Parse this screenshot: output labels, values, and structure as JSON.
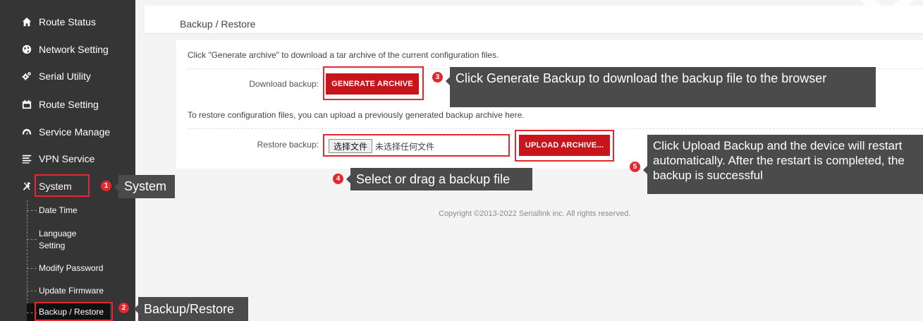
{
  "sidebar": {
    "items": [
      {
        "label": "Route Status",
        "icon": "home-icon"
      },
      {
        "label": "Network Setting",
        "icon": "globe-icon"
      },
      {
        "label": "Serial Utility",
        "icon": "cogs-icon"
      },
      {
        "label": "Route Setting",
        "icon": "calendar-icon"
      },
      {
        "label": "Service Manage",
        "icon": "dashboard-icon"
      },
      {
        "label": "VPN Service",
        "icon": "list-icon"
      },
      {
        "label": "System",
        "icon": "tools-icon"
      }
    ],
    "sub_items": [
      {
        "label": "Date Time"
      },
      {
        "label": "Language Setting"
      },
      {
        "label": "Modify Password"
      },
      {
        "label": "Update Firmware"
      },
      {
        "label": "Backup / Restore"
      }
    ]
  },
  "page": {
    "title": "Backup / Restore",
    "generate_desc": "Click \"Generate archive\" to download a tar archive of the current configuration files.",
    "download_label": "Download backup:",
    "generate_button": "GENERATE ARCHIVE",
    "restore_desc": "To restore configuration files, you can upload a previously generated backup archive here.",
    "restore_label": "Restore backup:",
    "choose_file_button": "选择文件",
    "no_file_text": "未选择任何文件",
    "upload_button": "UPLOAD ARCHIVE...",
    "copyright": "Copyright ©2013-2022 Seriallink inc. All rights reserved."
  },
  "annotations": [
    {
      "num": "1",
      "text": "System"
    },
    {
      "num": "2",
      "text": "Backup/Restore"
    },
    {
      "num": "3",
      "text": "Click Generate Backup to download the backup file to the browser"
    },
    {
      "num": "4",
      "text": "Select or drag a backup file"
    },
    {
      "num": "5",
      "text": "Click Upload Backup and the device will restart automatically. After the restart is completed, the backup is successful"
    }
  ],
  "colors": {
    "sidebar_bg": "#353535",
    "accent_red": "#c8151b",
    "annotation_red": "#e5282f",
    "callout_bg": "#4b4b4b"
  }
}
